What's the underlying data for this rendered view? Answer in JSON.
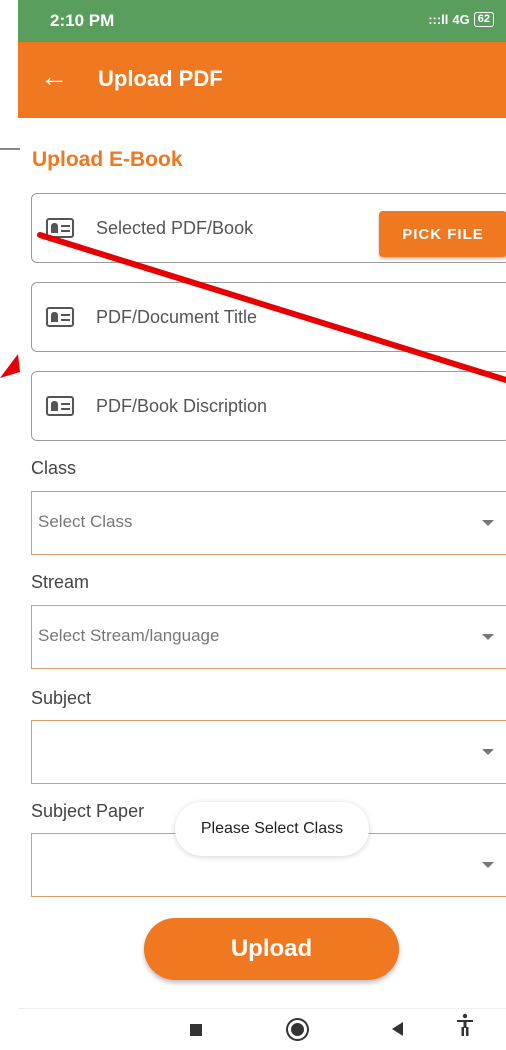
{
  "status_bar": {
    "time": "2:10 PM",
    "signal": ":::ll",
    "network": "4G",
    "battery": "62"
  },
  "app_bar": {
    "back_glyph": "←",
    "title": "Upload PDF"
  },
  "form": {
    "heading": "Upload E-Book",
    "picked_file": {
      "label": "Selected PDF/Book",
      "button": "PICK FILE",
      "icon": "contact-card-icon"
    },
    "title": {
      "placeholder": "PDF/Document Title",
      "icon": "contact-card-icon"
    },
    "description": {
      "placeholder": "PDF/Book Discription",
      "icon": "contact-card-icon"
    },
    "class": {
      "label": "Class",
      "value": "Select Class"
    },
    "stream": {
      "label": "Stream",
      "value": "Select Stream/language"
    },
    "subject": {
      "label": "Subject",
      "value": ""
    },
    "subject_paper": {
      "label": "Subject Paper",
      "value": ""
    },
    "submit": "Upload"
  },
  "toast": "Please Select Class",
  "nav_bar": {
    "icons": [
      "recents-square-icon",
      "home-circle-icon",
      "back-triangle-icon",
      "accessibility-icon"
    ],
    "a11y_glyph": "Ὣ9"
  },
  "colors": {
    "accent": "#f07820",
    "status_bar": "#5a9e5d",
    "annotation_arrow": "#e60000"
  }
}
